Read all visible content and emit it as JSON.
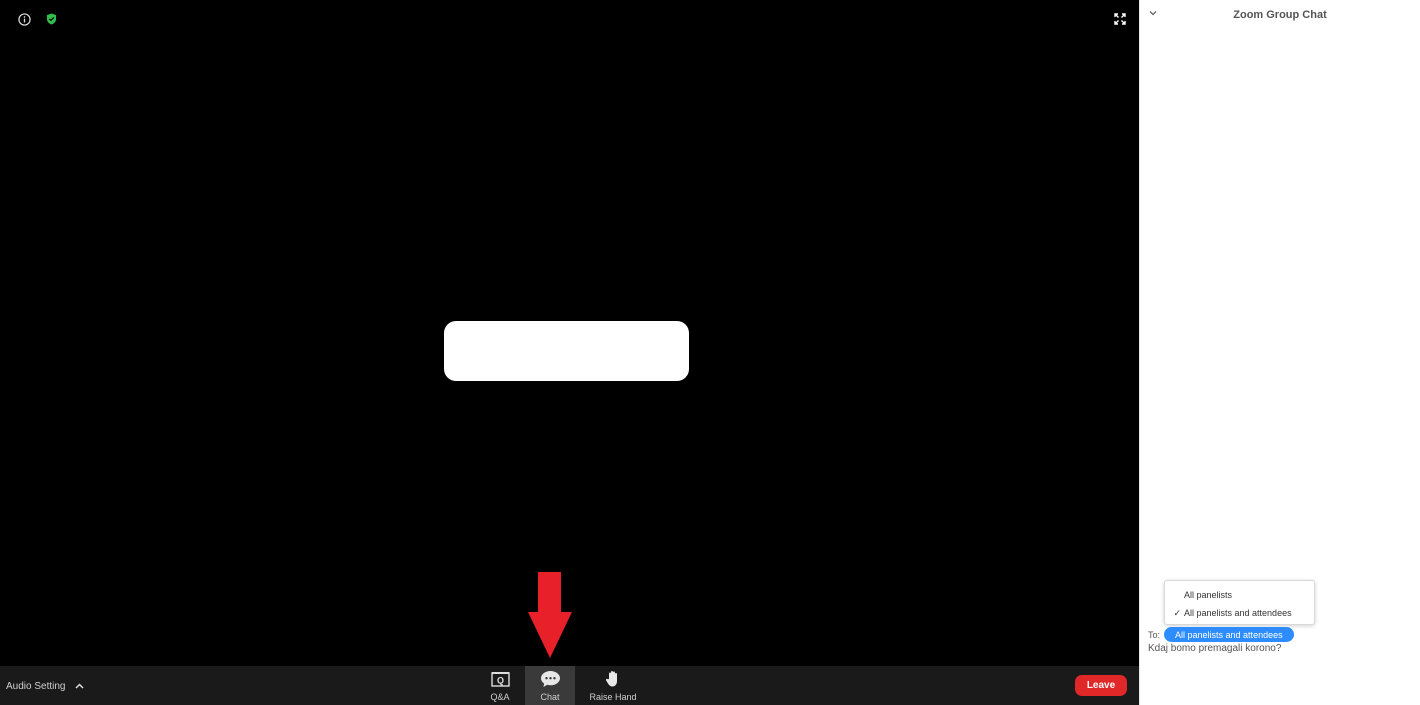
{
  "video": {
    "info_icon": "info-icon",
    "security_icon": "shield-check-icon",
    "fullscreen_icon": "fullscreen-icon"
  },
  "toolbar": {
    "audio_setting_label": "Audio Setting",
    "qa_label": "Q&A",
    "chat_label": "Chat",
    "raise_hand_label": "Raise Hand",
    "leave_label": "Leave"
  },
  "chat": {
    "title": "Zoom Group Chat",
    "menu_items": [
      {
        "label": "All panelists",
        "checked": false
      },
      {
        "label": "All panelists and attendees",
        "checked": true
      }
    ],
    "check_mark": "✓",
    "to_label": "To:",
    "to_recipient": "All panelists and attendees",
    "input_text": "Kdaj bomo premagali korono?"
  },
  "colors": {
    "leave_red": "#e02828",
    "pill_blue": "#2d8cff",
    "security_green": "#2fbf4a",
    "arrow_red": "#e8202a"
  }
}
